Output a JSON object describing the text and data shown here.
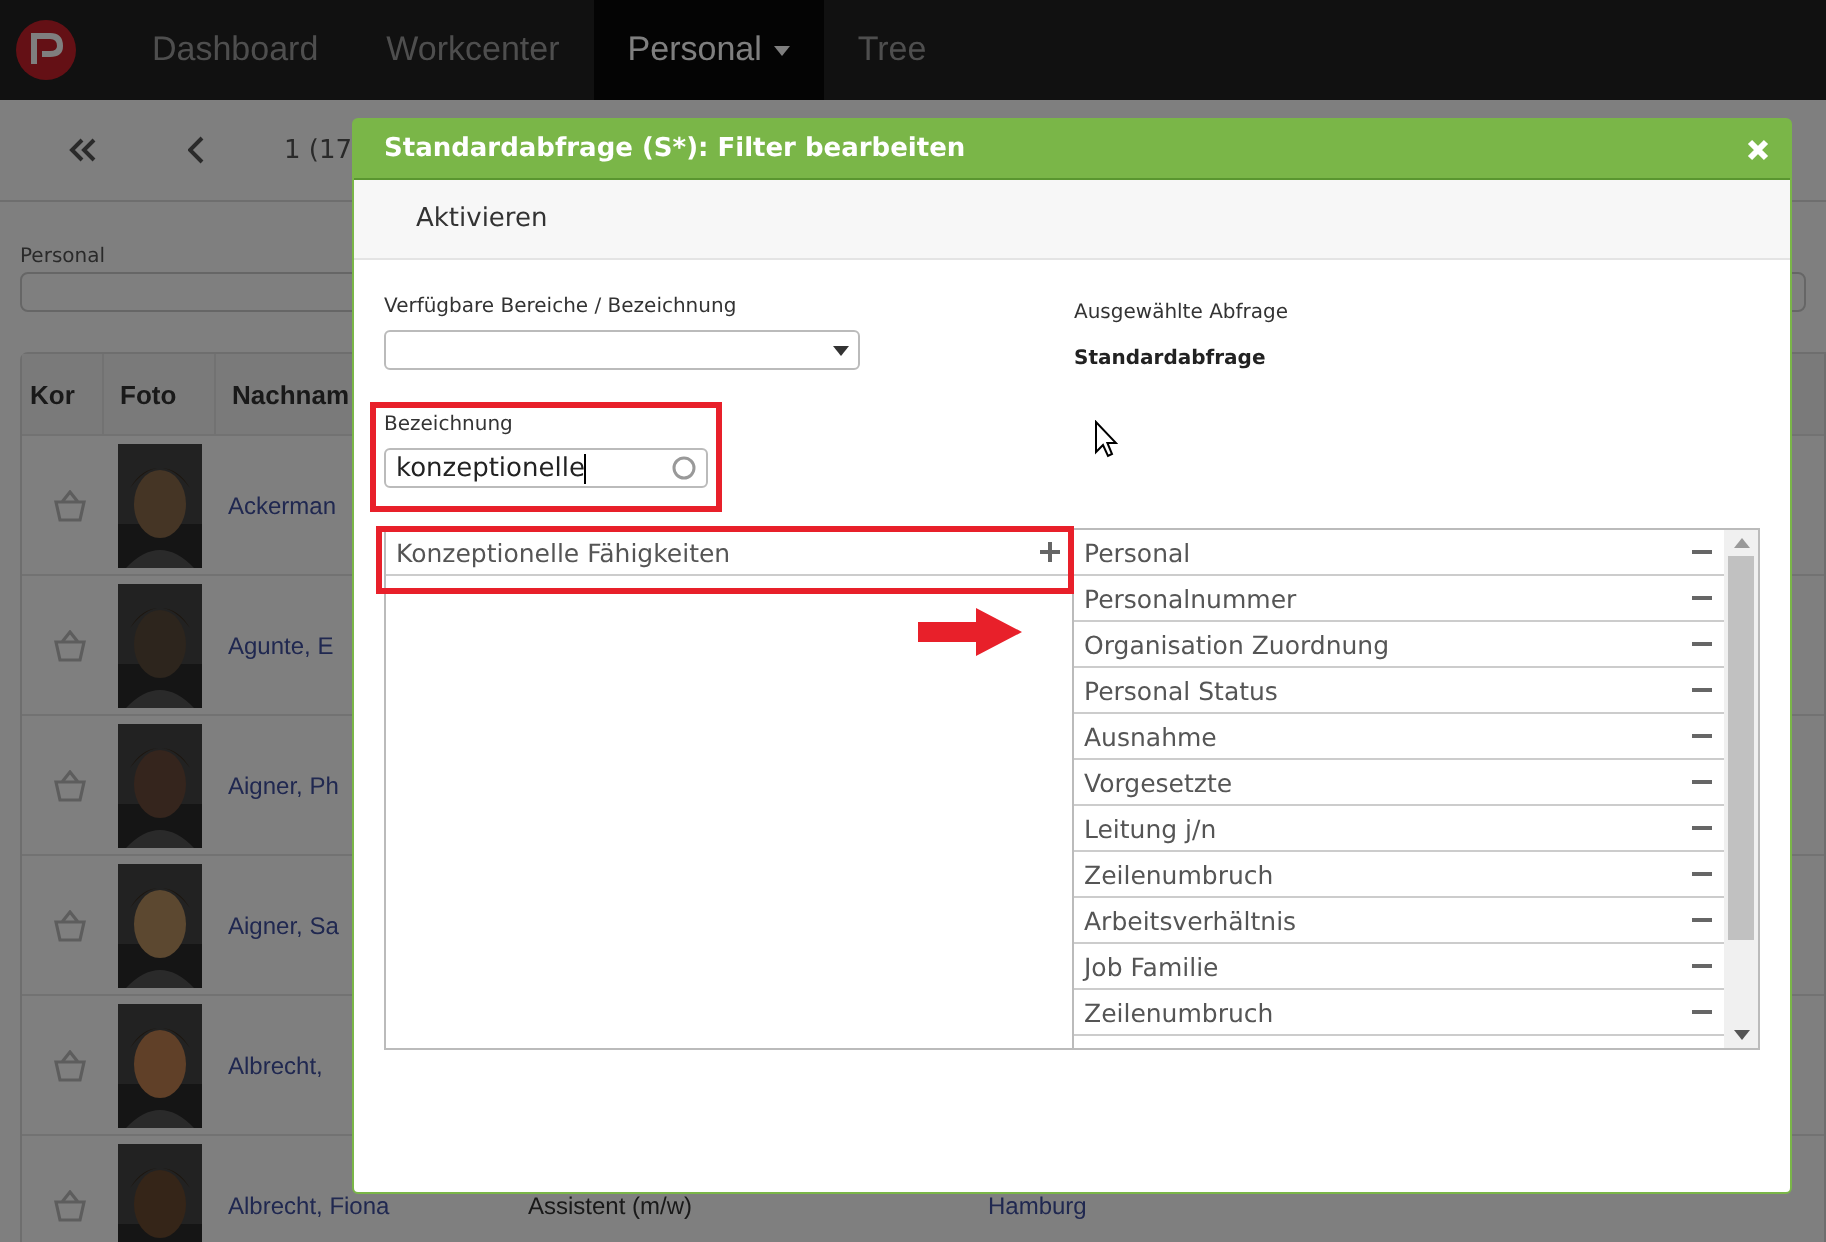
{
  "navbar": {
    "tabs": [
      {
        "label": "Dashboard",
        "selected": false,
        "caret": false
      },
      {
        "label": "Workcenter",
        "selected": false,
        "caret": false
      },
      {
        "label": "Personal",
        "selected": true,
        "caret": true
      },
      {
        "label": "Tree",
        "selected": false,
        "caret": false
      }
    ]
  },
  "pager": {
    "text": "1 (17"
  },
  "filter": {
    "label": "Personal"
  },
  "table": {
    "columns": [
      "Kor",
      "Foto",
      "Nachnam"
    ],
    "rows": [
      {
        "name": "Ackerman"
      },
      {
        "name": "Agunte, E"
      },
      {
        "name": "Aigner, Ph"
      },
      {
        "name": "Aigner, Sa"
      },
      {
        "name": "Albrecht,"
      },
      {
        "name": "Albrecht, Fiona",
        "column_4": "Assistent (m/w)",
        "column_5": "Hamburg"
      }
    ]
  },
  "dialog": {
    "title": "Standardabfrage (S*): Filter bearbeiten",
    "toolbar": [
      "Aktivieren"
    ],
    "available_label": "Verfügbare Bereiche / Bezeichnung",
    "selected_label": "Ausgewählte Abfrage",
    "selected_value": "Standardabfrage",
    "search": {
      "label": "Bezeichnung",
      "value": "konzeptionelle"
    },
    "available_items": [
      {
        "label": "Konzeptionelle Fähigkeiten"
      }
    ],
    "selected_items": [
      {
        "label": "Personal"
      },
      {
        "label": "Personalnummer"
      },
      {
        "label": "Organisation Zuordnung"
      },
      {
        "label": "Personal Status"
      },
      {
        "label": "Ausnahme"
      },
      {
        "label": "Vorgesetzte"
      },
      {
        "label": "Leitung j/n"
      },
      {
        "label": "Zeilenumbruch"
      },
      {
        "label": "Arbeitsverhältnis"
      },
      {
        "label": "Job Familie"
      },
      {
        "label": "Zeilenumbruch"
      }
    ]
  }
}
